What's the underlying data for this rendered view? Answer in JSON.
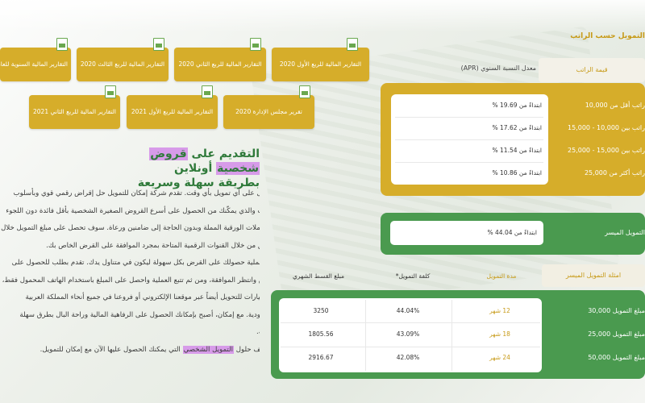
{
  "reports": [
    {
      "label": "التقارير المالية للربع الأول 2020"
    },
    {
      "label": "التقارير المالية للربع الثاني 2020"
    },
    {
      "label": "التقارير المالية للربع الثالث 2020"
    },
    {
      "label": "التقارير المالية السنوية للعام"
    },
    {
      "label": "تقرير مجلس الإدارة 2020"
    },
    {
      "label": "التقارير المالية للربع الأول 2021"
    },
    {
      "label": "التقارير المالية للربع الثاني 2021"
    }
  ],
  "article": {
    "headline_pre": "التقديم على ",
    "headline_hl1": "قروض",
    "headline_mid": " ",
    "headline_hl2": "شخصية",
    "headline_post": " أونلاين بطريقة سهلة وسريعة",
    "para1": "احصل على أي تمويل بأي وقت. تقدم شركة إمكان للتمويل حل إقراض رقمي قوي وبأسلوب حديث والذي يمكّنك من الحصول على أسرع القروض الصغيرة الشخصية بأقل فائدة دون اللجوء للمعاملات الورقية المملة وبدون الحاجة إلى ضامنين ورعاة. سوف تحصل على مبلغ التمويل خلال دقائق من خلال القنوات الرقمية المتاحة بمجرد الموافقة على القرض الخاص بك.",
    "para2": "تتم عملية حصولك على القرض بكل سهولة ليكون في متناول يدك. تقدم بطلب للحصول على قرض وانتظر الموافقة، ومن ثم تتبع العملية واحصل على المبلغ باستخدام الهاتف المحمول فقط، مع خيارات للتحويل أيضاً عبر موقعنا الإلكتروني أو فروعنا في جميع أنحاء المملكة العربية السعودية. مع إمكان، أصبح بإمكانك الحصول على الرفاهية المالية وراحة البال بطرق سهلة للغاية.",
    "para3_pre": "اكتشف حلول ",
    "para3_hl": "التمويل الشخصي",
    "para3_post": " التي يمكنك الحصول عليها الآن مع إمكان للتمويل."
  },
  "salary": {
    "title": "التمويل حسب الراتب",
    "col_salary": "قيمة الراتب",
    "col_apr": "معدل النسبة السنوي (APR)",
    "rows": [
      {
        "range": "راتب أقل من 10,000",
        "rate": "ابتداءً من 19.69 %"
      },
      {
        "range": "راتب بين 10,000 - 15,000",
        "rate": "ابتداءً من 17.62 %"
      },
      {
        "range": "راتب بين 15,000 - 25,000",
        "rate": "ابتداءً من 11.54 %"
      },
      {
        "range": "راتب أكثر من 25,000",
        "rate": "ابتداءً من 10.86 %"
      }
    ]
  },
  "easy": {
    "label": "التمويل الميسر",
    "value": "ابتداءً من 44.04 %"
  },
  "examples": {
    "title": "امثلة التمويل الميسر",
    "col_duration": "مدة التمويل",
    "col_cost": "كلفة التمويل*",
    "col_installment": "مبلغ القسط الشهري",
    "rows": [
      {
        "amount": "مبلغ التمويل 30,000",
        "duration": "12 شهر",
        "cost": "44.04%",
        "installment": "3250"
      },
      {
        "amount": "مبلغ التمويل 25,000",
        "duration": "18 شهر",
        "cost": "43.09%",
        "installment": "1805.56"
      },
      {
        "amount": "مبلغ التمويل 50,000",
        "duration": "24 شهر",
        "cost": "42.08%",
        "installment": "2916.67"
      }
    ]
  },
  "colors": {
    "gold": "#d6ad2a",
    "green": "#4a9a4f",
    "highlight": "#d79be9"
  }
}
